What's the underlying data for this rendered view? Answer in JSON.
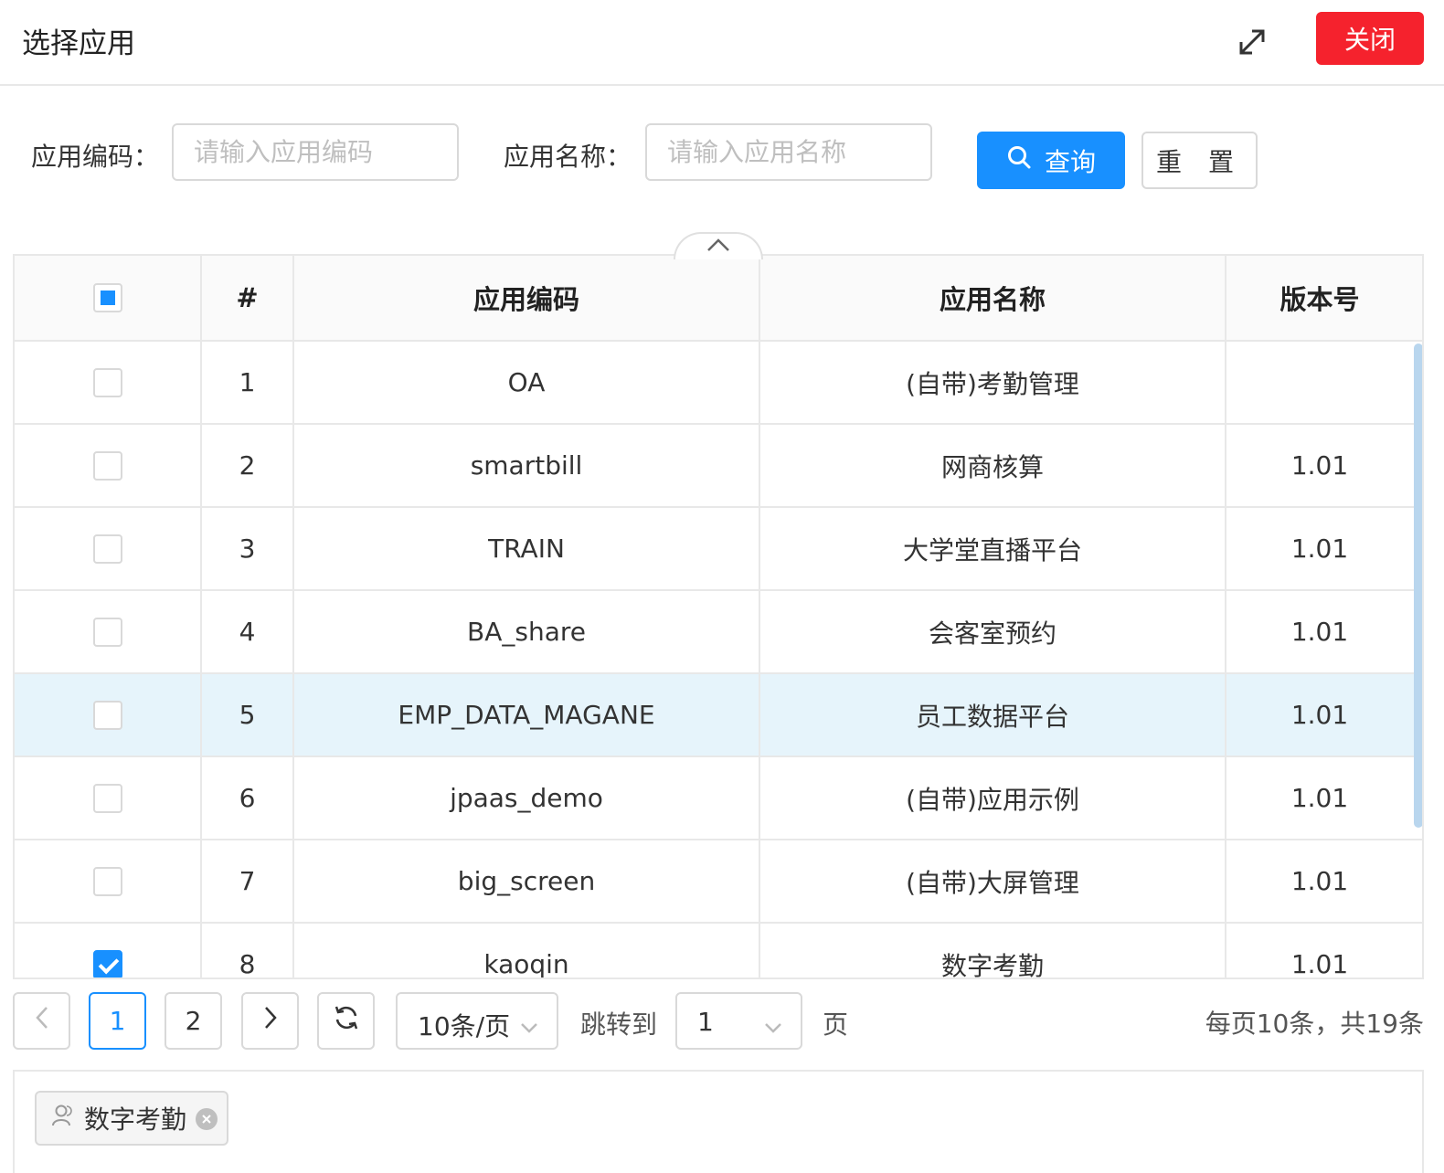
{
  "header": {
    "title": "选择应用",
    "close_label": "关闭"
  },
  "search": {
    "code_label": "应用编码：",
    "code_placeholder": "请输入应用编码",
    "name_label": "应用名称：",
    "name_placeholder": "请输入应用名称",
    "query_label": "查询",
    "reset_label": "重 置"
  },
  "table": {
    "columns": [
      "#",
      "应用编码",
      "应用名称",
      "版本号"
    ],
    "rows": [
      {
        "index": "1",
        "code": "OA",
        "name": "(自带)考勤管理",
        "version": "",
        "checked": false,
        "highlighted": false
      },
      {
        "index": "2",
        "code": "smartbill",
        "name": "网商核算",
        "version": "1.01",
        "checked": false,
        "highlighted": false
      },
      {
        "index": "3",
        "code": "TRAIN",
        "name": "大学堂直播平台",
        "version": "1.01",
        "checked": false,
        "highlighted": false
      },
      {
        "index": "4",
        "code": "BA_share",
        "name": "会客室预约",
        "version": "1.01",
        "checked": false,
        "highlighted": false
      },
      {
        "index": "5",
        "code": "EMP_DATA_MAGANE",
        "name": "员工数据平台",
        "version": "1.01",
        "checked": false,
        "highlighted": true
      },
      {
        "index": "6",
        "code": "jpaas_demo",
        "name": "(自带)应用示例",
        "version": "1.01",
        "checked": false,
        "highlighted": false
      },
      {
        "index": "7",
        "code": "big_screen",
        "name": "(自带)大屏管理",
        "version": "1.01",
        "checked": false,
        "highlighted": false
      },
      {
        "index": "8",
        "code": "kaoqin",
        "name": "数字考勤",
        "version": "1.01",
        "checked": true,
        "highlighted": false
      }
    ]
  },
  "pagination": {
    "pages": [
      "1",
      "2"
    ],
    "current_page": "1",
    "page_size": "10条/页",
    "jump_label": "跳转到",
    "jump_value": "1",
    "page_suffix": "页",
    "summary": "每页10条，共19条"
  },
  "selected": {
    "tags": [
      "数字考勤"
    ]
  },
  "colors": {
    "primary": "#1890ff",
    "danger": "#f5222d",
    "highlight_row": "#e6f4fb"
  },
  "icons": [
    "expand-icon",
    "search-icon",
    "chevron-up-icon",
    "chevron-left-icon",
    "chevron-right-icon",
    "refresh-icon",
    "chevron-down-icon",
    "user-icon",
    "close-circle-icon"
  ]
}
